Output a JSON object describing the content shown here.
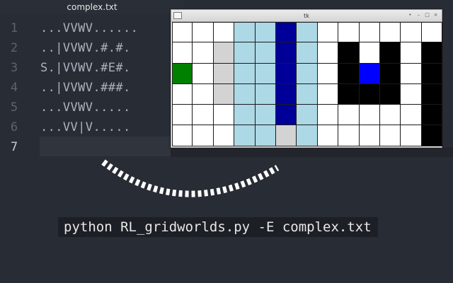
{
  "editor": {
    "tab_title": "complex.txt",
    "line_numbers": [
      "1",
      "2",
      "3",
      "4",
      "5",
      "6",
      "7"
    ],
    "lines": [
      "...VVWV......",
      "..|VVWV.#.#.",
      "S.|VVWV.#E#.",
      "..|VVWV.###.",
      "...VVWV.....",
      "...VV|V.....",
      ""
    ],
    "active_line": 7
  },
  "tk_window": {
    "title": "tk",
    "controls": {
      "pin": "•",
      "minimize": "–",
      "maximize": "□",
      "close": "×"
    },
    "grid": {
      "rows": 6,
      "cols": 13,
      "cells": [
        [
          "empty",
          "empty",
          "empty",
          "water",
          "water",
          "deep",
          "water",
          "empty",
          "empty",
          "empty",
          "empty",
          "empty",
          "empty"
        ],
        [
          "empty",
          "empty",
          "wind",
          "water",
          "water",
          "deep",
          "water",
          "empty",
          "wall",
          "empty",
          "wall",
          "empty",
          "wall"
        ],
        [
          "start",
          "empty",
          "wind",
          "water",
          "water",
          "deep",
          "water",
          "empty",
          "wall",
          "goal",
          "wall",
          "empty",
          "wall"
        ],
        [
          "empty",
          "empty",
          "wind",
          "water",
          "water",
          "deep",
          "water",
          "empty",
          "wall",
          "wall",
          "wall",
          "empty",
          "wall"
        ],
        [
          "empty",
          "empty",
          "empty",
          "water",
          "water",
          "deep",
          "water",
          "empty",
          "empty",
          "empty",
          "empty",
          "empty",
          "wall"
        ],
        [
          "empty",
          "empty",
          "empty",
          "water",
          "water",
          "wind",
          "water",
          "empty",
          "empty",
          "empty",
          "empty",
          "empty",
          "wall"
        ]
      ]
    },
    "colors": {
      "empty": "#ffffff",
      "wall": "#000000",
      "water": "#add8e6",
      "deep": "#000099",
      "wind": "#d3d3d3",
      "goal": "#0000ff",
      "start": "#008000"
    }
  },
  "command": {
    "text": "python RL_gridworlds.py -E complex.txt"
  }
}
